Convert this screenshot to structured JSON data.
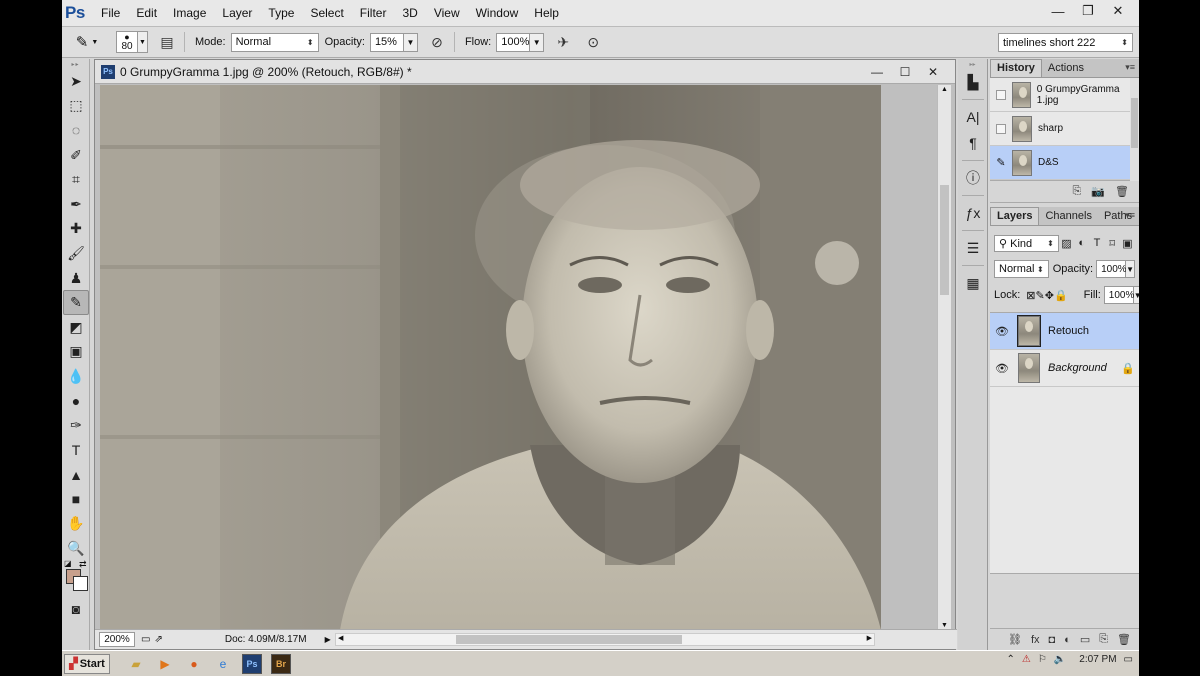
{
  "app": {
    "logo": "Ps",
    "menu": [
      "File",
      "Edit",
      "Image",
      "Layer",
      "Type",
      "Select",
      "Filter",
      "3D",
      "View",
      "Window",
      "Help"
    ],
    "window_controls": {
      "minimize": "—",
      "restore": "❐",
      "close": "✕"
    }
  },
  "options_bar": {
    "brush_size": "80",
    "mode_label": "Mode:",
    "mode_value": "Normal",
    "opacity_label": "Opacity:",
    "opacity_value": "15%",
    "flow_label": "Flow:",
    "flow_value": "100%",
    "workspace_preset": "timelines short  222"
  },
  "document": {
    "title": "0 GrumpyGramma 1.jpg @ 200% (Retouch, RGB/8#) *",
    "zoom": "200%",
    "doc_info": "Doc: 4.09M/8.17M"
  },
  "history_panel": {
    "tabs": [
      "History",
      "Actions"
    ],
    "items": [
      {
        "label": "0 GrumpyGramma 1.jpg",
        "selected": false
      },
      {
        "label": "sharp",
        "selected": false
      },
      {
        "label": "D&S",
        "selected": true
      }
    ]
  },
  "layers_panel": {
    "tabs": [
      "Layers",
      "Channels",
      "Paths"
    ],
    "kind_filter": "Kind",
    "blend_mode": "Normal",
    "opacity_label": "Opacity:",
    "opacity_value": "100%",
    "lock_label": "Lock:",
    "fill_label": "Fill:",
    "fill_value": "100%",
    "layers": [
      {
        "name": "Retouch",
        "selected": true,
        "locked": false
      },
      {
        "name": "Background",
        "selected": false,
        "locked": true
      }
    ]
  },
  "taskbar": {
    "start_label": "Start",
    "clock": "2:07 PM",
    "apps": [
      "folder",
      "media-player",
      "firefox",
      "ie",
      "Ps",
      "Br"
    ]
  },
  "colors": {
    "foreground": "#c8a08c",
    "background": "#ffffff",
    "selection": "#b8cff7"
  }
}
